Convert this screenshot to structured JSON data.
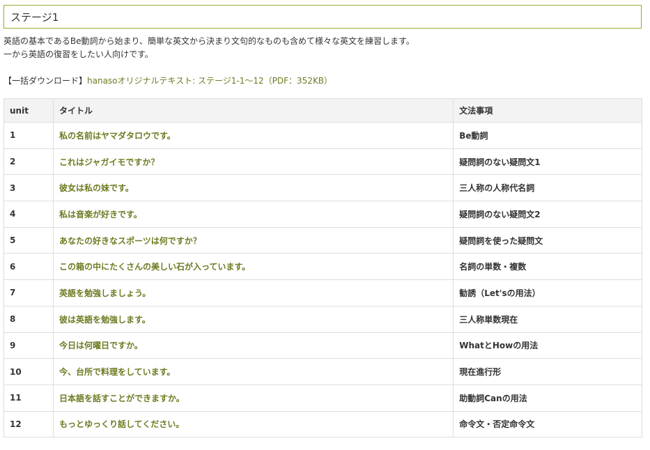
{
  "stage": {
    "title": "ステージ1"
  },
  "description": {
    "line1": "英語の基本であるBe動詞から始まり、簡単な英文から決まり文句的なものも含めて様々な英文を練習します。",
    "line2": "一から英語の復習をしたい人向けです。"
  },
  "download": {
    "prefix": "【一括ダウンロード】",
    "link_text": "hanasoオリジナルテキスト: ステージ1-1〜12（PDF：352KB）"
  },
  "table": {
    "headers": [
      "unit",
      "タイトル",
      "文法事項"
    ],
    "rows": [
      {
        "unit": "1",
        "title": "私の名前はヤマダタロウです。",
        "grammar": "Be動詞"
      },
      {
        "unit": "2",
        "title": "これはジャガイモですか？",
        "grammar": "疑問詞のない疑問文1"
      },
      {
        "unit": "3",
        "title": "彼女は私の妹です。",
        "grammar": "三人称の人称代名詞"
      },
      {
        "unit": "4",
        "title": "私は音楽が好きです。",
        "grammar": "疑問詞のない疑問文2"
      },
      {
        "unit": "5",
        "title": "あなたの好きなスポーツは何ですか？",
        "grammar": "疑問詞を使った疑問文"
      },
      {
        "unit": "6",
        "title": "この箱の中にたくさんの美しい石が入っています。",
        "grammar": "名詞の単数・複数"
      },
      {
        "unit": "7",
        "title": "英語を勉強しましょう。",
        "grammar": "勧誘（Let'sの用法）"
      },
      {
        "unit": "8",
        "title": "彼は英語を勉強します。",
        "grammar": "三人称単数現在"
      },
      {
        "unit": "9",
        "title": "今日は何曜日ですか。",
        "grammar": "WhatとHowの用法"
      },
      {
        "unit": "10",
        "title": "今、台所で料理をしています。",
        "grammar": "現在進行形"
      },
      {
        "unit": "11",
        "title": "日本語を話すことができますか。",
        "grammar": "助動詞Canの用法"
      },
      {
        "unit": "12",
        "title": "もっとゆっくり話してください。",
        "grammar": "命令文・否定命令文"
      }
    ]
  },
  "colors": {
    "accent": "#6f7a22",
    "border_accent": "#9aa82c",
    "header_bg": "#f3f3f3"
  }
}
